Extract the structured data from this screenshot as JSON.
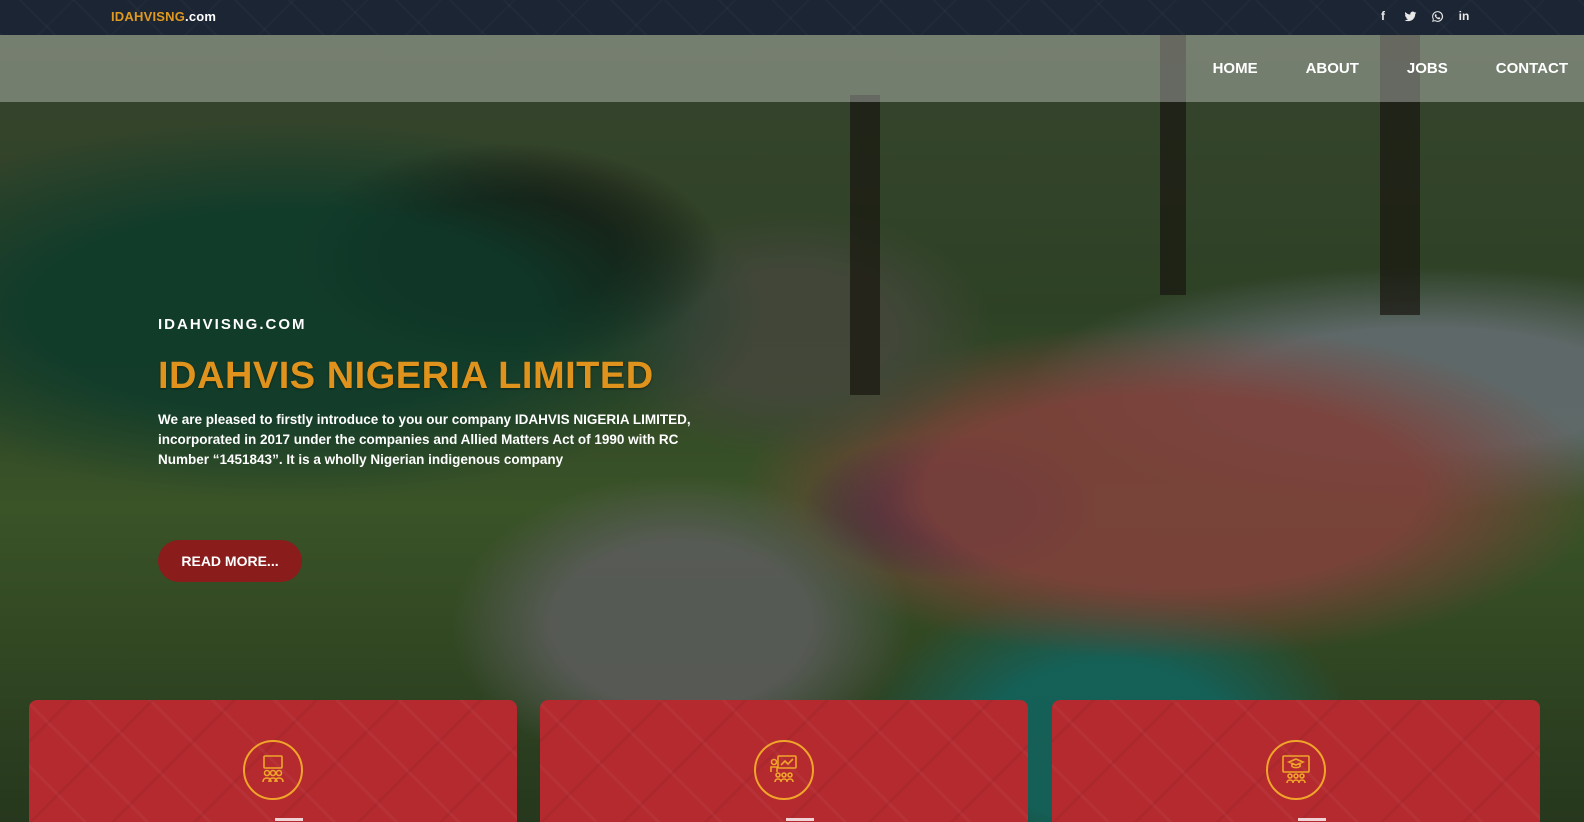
{
  "topbar": {
    "brand_part1": "IDAHVISNG",
    "brand_part2": ".com",
    "social": [
      {
        "icon": "facebook-icon",
        "glyph": "f"
      },
      {
        "icon": "twitter-icon",
        "glyph": ""
      },
      {
        "icon": "whatsapp-icon",
        "glyph": ""
      },
      {
        "icon": "linkedin-icon",
        "glyph": "in"
      }
    ]
  },
  "nav": {
    "items": [
      "HOME",
      "ABOUT",
      "JOBS",
      "CONTACT"
    ]
  },
  "hero": {
    "kicker": "IDAHVISNG.COM",
    "title": "IDAHVIS NIGERIA LIMITED",
    "description": "We are pleased to firstly introduce to you our company IDAHVIS NIGERIA LIMITED, incorporated in 2017 under the companies and Allied Matters Act of 1990 with RC Number “1451843”. It is a wholly Nigerian indigenous company",
    "button_label": "READ MORE..."
  },
  "colors": {
    "accent_orange": "#e0931c",
    "button_red": "#8a1c1c",
    "card_red": "#b42a2f",
    "topbar": "#1c2533"
  },
  "cards": [
    {
      "icon": "group-learning-icon"
    },
    {
      "icon": "presentation-audience-icon"
    },
    {
      "icon": "graduation-classroom-icon"
    }
  ]
}
